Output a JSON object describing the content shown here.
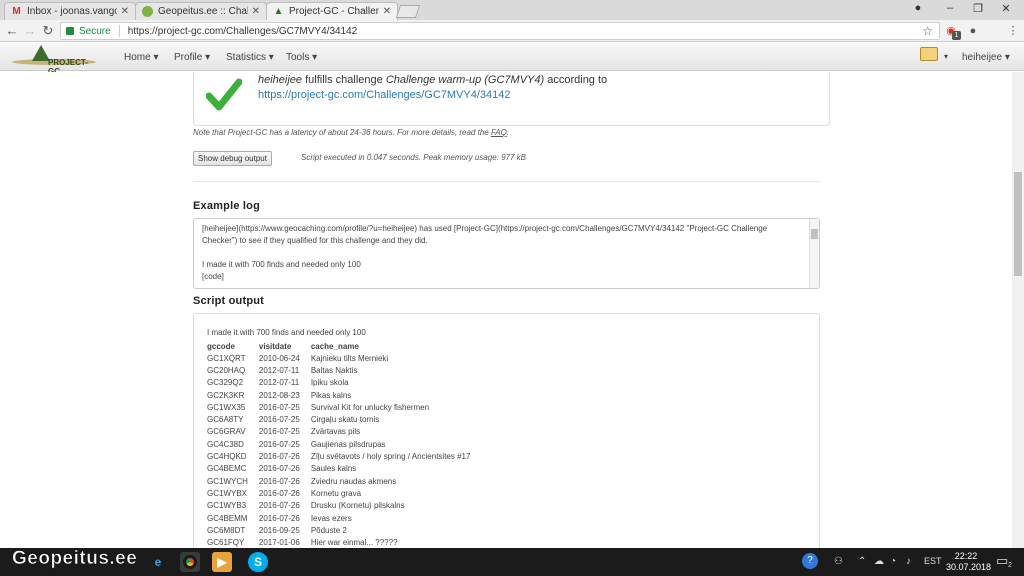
{
  "browser": {
    "tabs": [
      {
        "label": "Inbox - joonas.vangonen",
        "favicon": "gmail-icon",
        "active": false
      },
      {
        "label": "Geopeitus.ee :: Challenge",
        "favicon": "geopeitus-icon",
        "active": false
      },
      {
        "label": "Project-GC - Challenge ch",
        "favicon": "project-gc-icon",
        "active": true
      }
    ],
    "secure_label": "Secure",
    "url": "https://project-gc.com/Challenges/GC7MVY4/34142",
    "extension_badge": "1"
  },
  "site": {
    "logo_text": "PROJECT-GC",
    "menu": [
      "Home",
      "Profile",
      "Statistics",
      "Tools"
    ],
    "username": "heiheijee"
  },
  "result": {
    "user": "heiheijee",
    "text_mid": " fulfills challenge ",
    "challenge": "Challenge warm-up (GC7MVY4)",
    "text_end": " according to ",
    "link": "https://project-gc.com/Challenges/GC7MVY4/34142",
    "status_color": "#3bb03b"
  },
  "latency_note_prefix": "Note that Project-GC has a latency of about 24-36 hours. For more details, read the ",
  "latency_note_link": "FAQ",
  "latency_note_suffix": ".",
  "debug_button": "Show debug output",
  "exec_info": "Script executed in 0.047 seconds. Peak memory usage: 977 kB",
  "example_log": {
    "heading": "Example log",
    "text": "[heiheijee](https://www.geocaching.com/profile/?u=heiheijee) has used [Project-GC](https://project-gc.com/Challenges/GC7MVY4/34142 \"Project-GC Challenge Checker\") to see if they qualified for this challenge and they did.\n\nI made it with 700 finds and needed only 100\n[code]\n"
  },
  "script_output": {
    "heading": "Script output",
    "summary": "I made it with 700 finds and needed only 100",
    "columns": [
      "gccode",
      "visitdate",
      "cache_name"
    ],
    "rows": [
      [
        "GC1XQRT",
        "2010-06-24",
        "Kajnieku tilts Mernieki"
      ],
      [
        "GC20HAQ",
        "2012-07-11",
        "Baltas Naktis"
      ],
      [
        "GC329Q2",
        "2012-07-11",
        "Ipiku skola"
      ],
      [
        "GC2K3KR",
        "2012-08-23",
        "Pikas kalns"
      ],
      [
        "GC1WX35",
        "2016-07-25",
        "Survival Kit for unlucky fishermen"
      ],
      [
        "GC6A8TY",
        "2016-07-25",
        "Cirgaļu skatu tornis"
      ],
      [
        "GC6GRAV",
        "2016-07-25",
        "Zvārtavas pils"
      ],
      [
        "GC4C38D",
        "2016-07-25",
        "Gaujienas pilsdrupas"
      ],
      [
        "GC4HQKD",
        "2016-07-26",
        "Zīļu svētavots / holy spring / Ancientsites #17"
      ],
      [
        "GC4BEMC",
        "2016-07-26",
        "Saules kalns"
      ],
      [
        "GC1WYCH",
        "2016-07-26",
        "Zviedru naudas akmens"
      ],
      [
        "GC1WYBX",
        "2016-07-26",
        "Kornetu grava"
      ],
      [
        "GC1WYB3",
        "2016-07-26",
        "Drusku (Kornetu) pilskalns"
      ],
      [
        "GC4BEMM",
        "2016-07-26",
        "Ievas ezers"
      ],
      [
        "GC6M8DT",
        "2016-09-25",
        "Põduste 2"
      ],
      [
        "GC61FQY",
        "2017-01-06",
        "Hier war einmal... ?????"
      ]
    ]
  },
  "taskbar": {
    "logo": "Geopeitus.ee",
    "language": "EST",
    "time": "22:22",
    "date": "30.07.2018",
    "notifications": "2"
  }
}
